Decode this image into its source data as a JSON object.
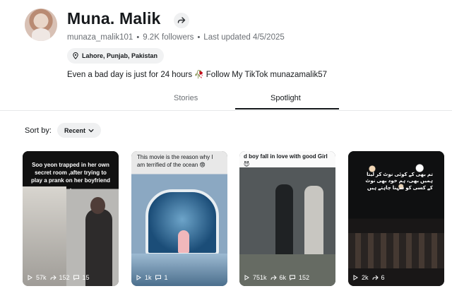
{
  "profile": {
    "name": "Muna. Malik",
    "username": "munaza_malik101",
    "followers": "9.2K followers",
    "updated": "Last updated 4/5/2025",
    "location": "Lahore, Punjab, Pakistan",
    "bio_text": "Even a bad day is just for 24 hours",
    "bio_emoji": "🥀",
    "bio_link_text": "Follow My TikTok munazamalik57"
  },
  "tabs": {
    "stories": "Stories",
    "spotlight": "Spotlight"
  },
  "sort": {
    "label": "Sort by:",
    "value": "Recent"
  },
  "cards": [
    {
      "caption": "Soo yeon trapped in her own secret room ,after trying to play a prank on her boyfriend .",
      "views": "57k",
      "shares": "152",
      "comments": "15"
    },
    {
      "caption": "This movie is the reason why I am terrified of the ocean 😨",
      "views": "1k",
      "comments": "1"
    },
    {
      "caption": "d boy fall in love with good Girl 😈",
      "views": "751k",
      "shares": "6k",
      "comments": "152"
    },
    {
      "caption": "تم بھی کے کوئی نوٹ کر لیتا ہمیں بھی، ہم خود بھی نوٹ کے کسی کو سہنا چاہتے ہیں",
      "views": "2k",
      "shares": "6"
    }
  ],
  "colors": {
    "text": "#16191c",
    "muted": "#6c7075",
    "chip": "#eff0f1"
  }
}
